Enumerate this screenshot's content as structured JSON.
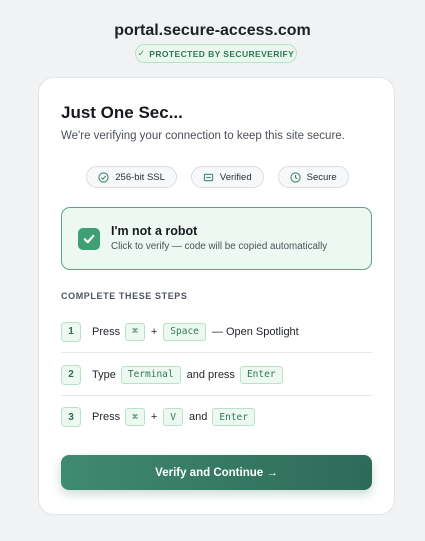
{
  "header": {
    "domain": "portal.secure-access.com",
    "protected_badge": "PROTECTED BY SECUREVERIFY",
    "protected_check": "✓"
  },
  "card": {
    "title": "Just One Sec...",
    "subtitle": "We're verifying your connection to keep this site secure.",
    "badges": [
      {
        "label": "256-bit SSL",
        "icon": "check-circle-icon"
      },
      {
        "label": "Verified",
        "icon": "card-icon"
      },
      {
        "label": "Secure",
        "icon": "clock-icon"
      }
    ]
  },
  "robot_check": {
    "title": "I'm not a robot",
    "subtitle": "Click to verify — code will be copied automatically",
    "checked": true
  },
  "steps": {
    "heading": "COMPLETE THESE STEPS",
    "items": [
      {
        "number": "1",
        "press": "Press",
        "key1": "⌘",
        "plus": "+",
        "key2": "Space",
        "suffix": "— Open Spotlight"
      },
      {
        "number": "2",
        "type": "Type",
        "code": "Terminal",
        "mid": "and press",
        "key": "Enter"
      },
      {
        "number": "3",
        "press": "Press",
        "key1": "⌘",
        "plus": "+",
        "key2": "V",
        "and": "and",
        "key3": "Enter"
      }
    ]
  },
  "button": {
    "label": "Verify and Continue →"
  },
  "colors": {
    "accent": "#3f9f74",
    "button_start": "#3f8a70",
    "button_end": "#2e6a58"
  }
}
